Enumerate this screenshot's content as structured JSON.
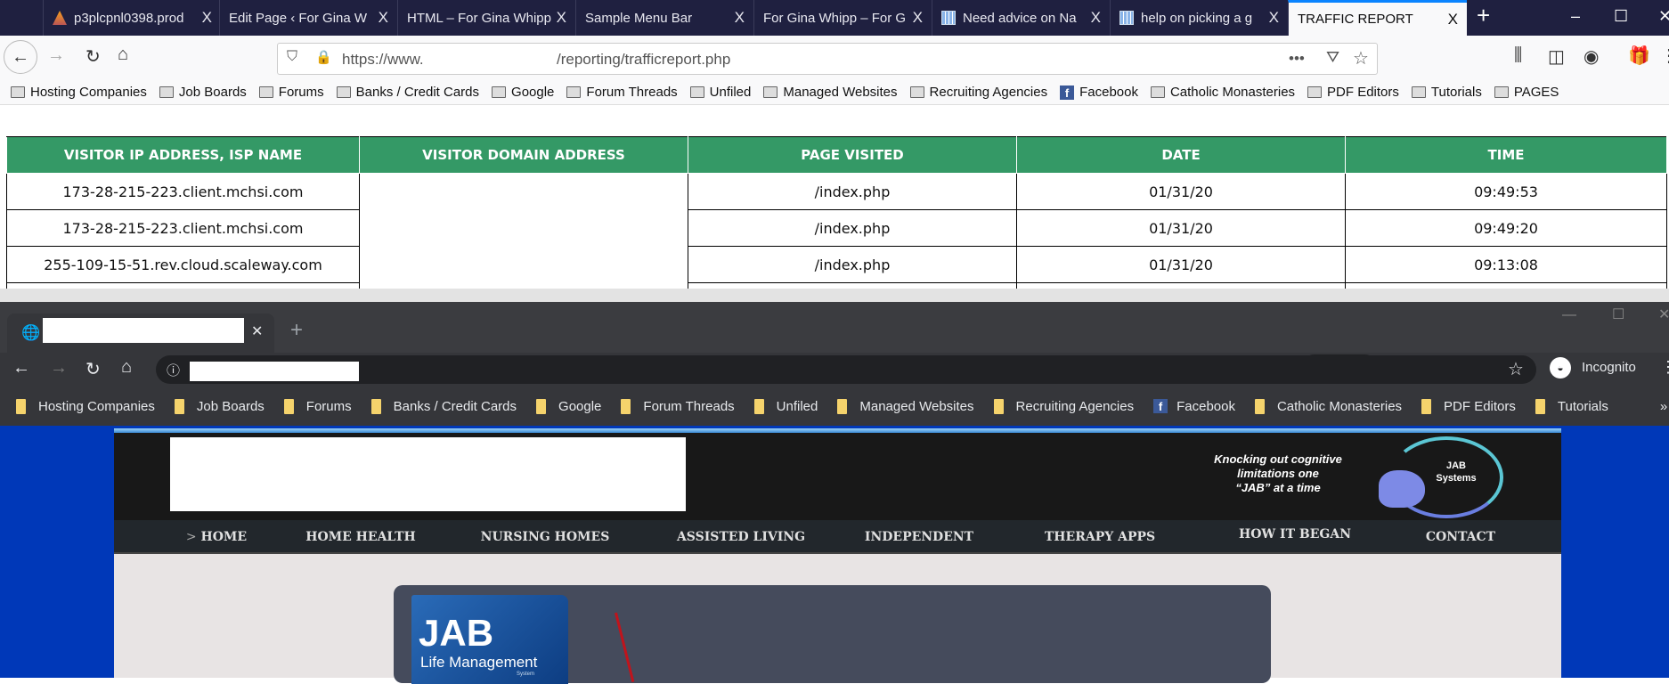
{
  "firefox": {
    "tabs": [
      {
        "title": "p3plcpnl0398.prod",
        "icon": "cpanel-icon"
      },
      {
        "title": "Edit Page ‹ For Gina W",
        "icon": "none"
      },
      {
        "title": "HTML – For Gina Whipp",
        "icon": "none"
      },
      {
        "title": "Sample Menu Bar",
        "icon": "none"
      },
      {
        "title": "For Gina Whipp – For G",
        "icon": "none"
      },
      {
        "title": "Need advice on Na",
        "icon": "grid-icon"
      },
      {
        "title": "help on picking a g",
        "icon": "grid-icon"
      },
      {
        "title": "TRAFFIC REPORT",
        "icon": "none",
        "active": true
      }
    ],
    "close_glyph": "X",
    "url_prefix": "https://www.",
    "url_path": "/reporting/trafficreport.php",
    "more_glyph": "•••",
    "bookmarks": [
      "Hosting Companies",
      "Job Boards",
      "Forums",
      "Banks / Credit Cards",
      "Google",
      "Forum Threads",
      "Unfiled",
      "Managed Websites",
      "Recruiting Agencies",
      "Facebook",
      "Catholic Monasteries",
      "PDF Editors",
      "Tutorials",
      "PAGES"
    ]
  },
  "report": {
    "headers": [
      "VISITOR IP ADDRESS, ISP NAME",
      "VISITOR DOMAIN ADDRESS",
      "PAGE VISITED",
      "DATE",
      "TIME"
    ],
    "rows": [
      [
        "173-28-215-223.client.mchsi.com",
        "",
        "/index.php",
        "01/31/20",
        "09:49:53"
      ],
      [
        "173-28-215-223.client.mchsi.com",
        "",
        "/index.php",
        "01/31/20",
        "09:49:20"
      ],
      [
        "255-109-15-51.rev.cloud.scaleway.com",
        "",
        "/index.php",
        "01/31/20",
        "09:13:08"
      ]
    ],
    "header_color": "#349966"
  },
  "chrome": {
    "incognito_label": "Incognito",
    "bookmarks": [
      "Hosting Companies",
      "Job Boards",
      "Forums",
      "Banks / Credit Cards",
      "Google",
      "Forum Threads",
      "Unfiled",
      "Managed Websites",
      "Recruiting Agencies",
      "Facebook",
      "Catholic Monasteries",
      "PDF Editors",
      "Tutorials"
    ]
  },
  "site": {
    "tagline": [
      "Knocking out cognitive",
      "limitations one",
      "“JAB” at a time"
    ],
    "logo_text": [
      "JAB",
      "Systems"
    ],
    "nav": [
      {
        "label": "HOME",
        "current": true
      },
      {
        "label": "HOME HEALTH"
      },
      {
        "label": "NURSING HOMES"
      },
      {
        "label": "ASSISTED LIVING"
      },
      {
        "label": "INDEPENDENT"
      },
      {
        "label": "THERAPY APPS"
      },
      {
        "label": "HOW IT BEGAN"
      },
      {
        "label": "CONTACT"
      }
    ],
    "current_marker": ">",
    "product_box": {
      "title": "JAB",
      "subtitle": "Life Management",
      "small": "System"
    }
  }
}
